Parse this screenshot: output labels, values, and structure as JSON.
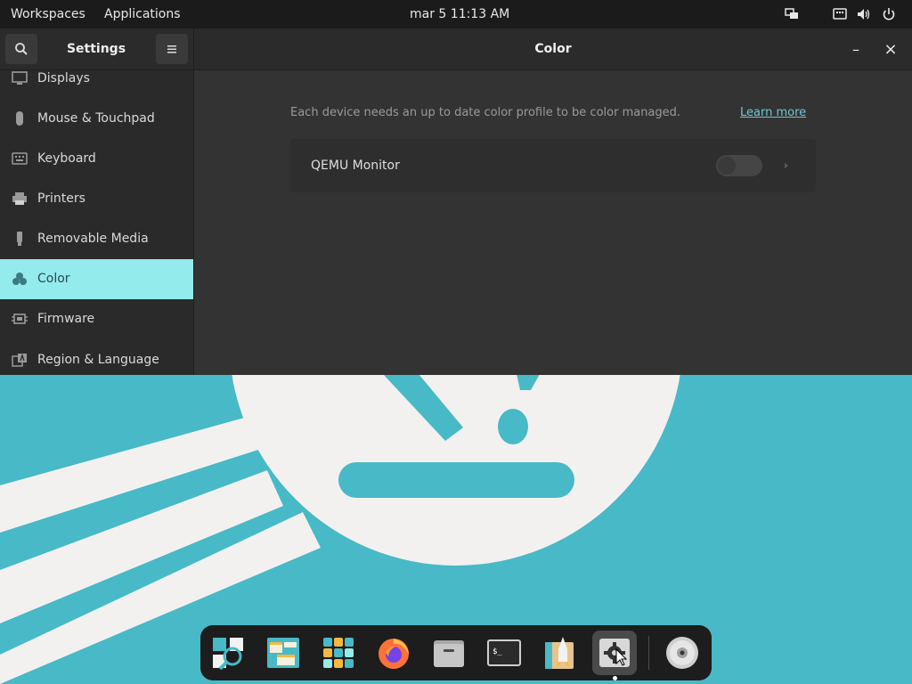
{
  "topbar": {
    "workspaces": "Workspaces",
    "applications": "Applications",
    "clock": "mar 5  11:13 AM",
    "status_icons": [
      "display-icon",
      "keyboard-layout-icon",
      "volume-icon",
      "power-icon"
    ]
  },
  "window": {
    "sidebar_title": "Settings",
    "page_title": "Color",
    "search_icon": "search-icon",
    "menu_icon": "hamburger-menu-icon",
    "minimize": "–",
    "close": "×"
  },
  "sidebar": {
    "items": [
      {
        "label": "Displays",
        "icon": "display-icon"
      },
      {
        "label": "Mouse & Touchpad",
        "icon": "mouse-icon"
      },
      {
        "label": "Keyboard",
        "icon": "keyboard-icon"
      },
      {
        "label": "Printers",
        "icon": "printer-icon"
      },
      {
        "label": "Removable Media",
        "icon": "usb-icon"
      },
      {
        "label": "Color",
        "icon": "color-icon",
        "active": true
      },
      {
        "label": "Firmware",
        "icon": "chip-icon"
      },
      {
        "label": "Region & Language",
        "icon": "language-icon"
      }
    ]
  },
  "content": {
    "description": "Each device needs an up to date color profile to be color managed.",
    "learn_more": "Learn more",
    "devices": [
      {
        "name": "QEMU Monitor",
        "enabled": false
      }
    ]
  },
  "dock": {
    "apps": [
      "search-launcher-icon",
      "workspaces-icon",
      "app-library-icon",
      "firefox-icon",
      "files-icon",
      "terminal-icon",
      "popshop-icon",
      "settings-icon",
      "disc-icon"
    ],
    "active_app": "settings-icon"
  },
  "colors": {
    "accent": "#94ebeb",
    "wallpaper": "#48b9c7",
    "panel": "#1b1b1b",
    "window": "#333333"
  }
}
